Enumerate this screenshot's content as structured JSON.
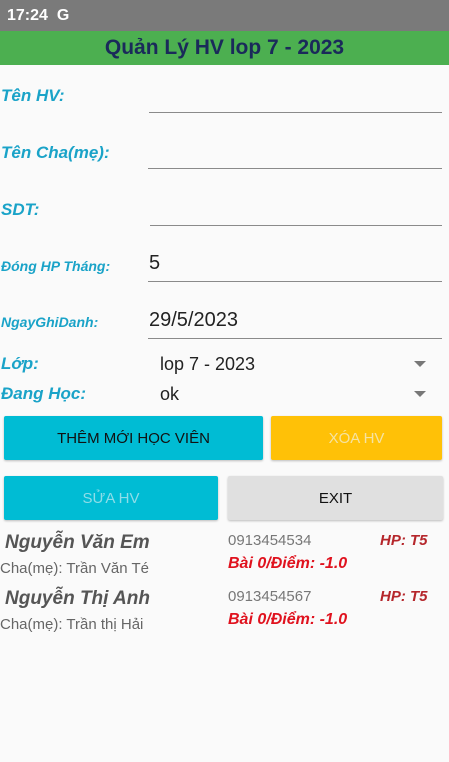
{
  "status_bar": {
    "time": "17:24",
    "app_icon": "G"
  },
  "title": "Quản Lý HV lop 7 - 2023",
  "form": {
    "ten_hv": {
      "label": "Tên HV:",
      "value": ""
    },
    "ten_cha_me": {
      "label": "Tên Cha(mẹ):",
      "value": ""
    },
    "sdt": {
      "label": "SDT:",
      "value": ""
    },
    "dong_hp_thang": {
      "label": "Đóng HP Tháng:",
      "value": "5"
    },
    "ngay_ghi_danh": {
      "label": "NgayGhiDanh:",
      "value": "29/5/2023"
    },
    "lop": {
      "label": "Lớp:",
      "value": "lop 7 - 2023"
    },
    "dang_hoc": {
      "label": "Đang Học:",
      "value": "ok"
    }
  },
  "buttons": {
    "add": "THÊM MỚI HỌC VIÊN",
    "delete": "XÓA HV",
    "edit": "SỬA HV",
    "exit": "EXIT"
  },
  "students": [
    {
      "name": "Nguyễn Văn Em",
      "parent": "Cha(mẹ): Trần Văn Té",
      "phone": "0913454534",
      "hp": "HP: T5",
      "score": "Bài 0/Điểm: -1.0"
    },
    {
      "name": "Nguyễn Thị Anh",
      "parent": "Cha(mẹ): Trần thị Hải",
      "phone": "0913454567",
      "hp": "HP: T5",
      "score": "Bài 0/Điểm: -1.0"
    }
  ]
}
